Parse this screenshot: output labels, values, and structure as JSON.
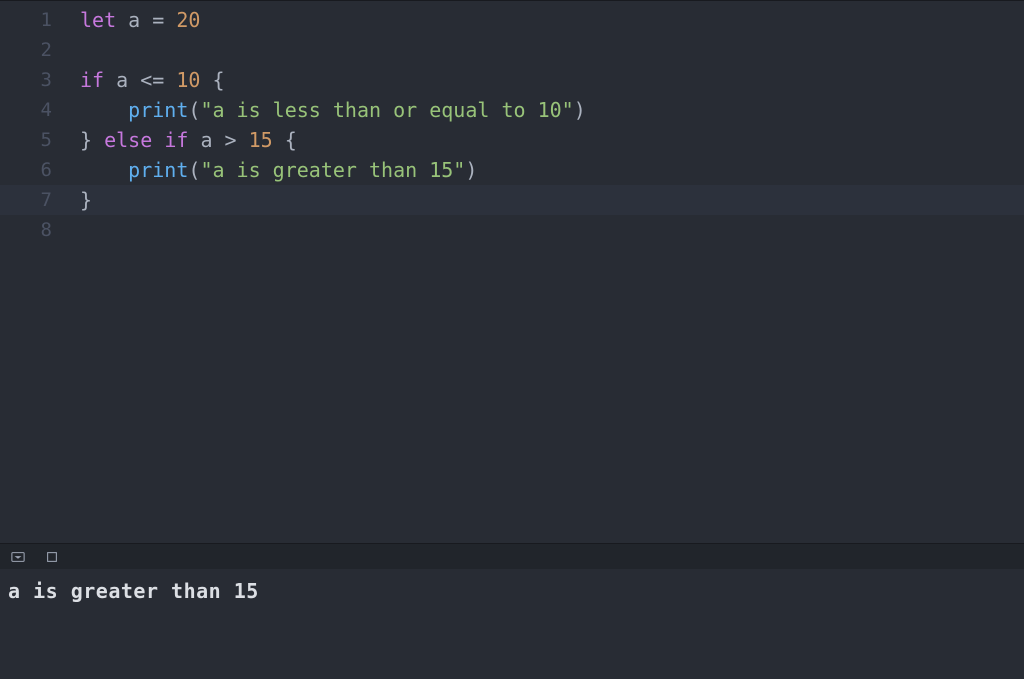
{
  "editor": {
    "lines": [
      {
        "num": "1",
        "highlighted": false
      },
      {
        "num": "2",
        "highlighted": false
      },
      {
        "num": "3",
        "highlighted": false
      },
      {
        "num": "4",
        "highlighted": false
      },
      {
        "num": "5",
        "highlighted": false
      },
      {
        "num": "6",
        "highlighted": false
      },
      {
        "num": "7",
        "highlighted": true
      },
      {
        "num": "8",
        "highlighted": false
      }
    ],
    "tokens": {
      "l1_let": "let",
      "l1_sp1": " ",
      "l1_a": "a",
      "l1_sp2": " ",
      "l1_eq": "=",
      "l1_sp3": " ",
      "l1_20": "20",
      "l3_if": "if",
      "l3_sp1": " ",
      "l3_a": "a",
      "l3_sp2": " ",
      "l3_lte": "<=",
      "l3_sp3": " ",
      "l3_10": "10",
      "l3_sp4": " ",
      "l3_brace": "{",
      "l4_indent": "    ",
      "l4_print": "print",
      "l4_lparen": "(",
      "l4_str": "\"a is less than or equal to 10\"",
      "l4_rparen": ")",
      "l5_rbrace": "}",
      "l5_sp1": " ",
      "l5_else": "else",
      "l5_sp2": " ",
      "l5_if": "if",
      "l5_sp3": " ",
      "l5_a": "a",
      "l5_sp4": " ",
      "l5_gt": ">",
      "l5_sp5": " ",
      "l5_15": "15",
      "l5_sp6": " ",
      "l5_lbrace": "{",
      "l6_indent": "    ",
      "l6_print": "print",
      "l6_lparen": "(",
      "l6_str": "\"a is greater than 15\"",
      "l6_rparen": ")",
      "l7_rbrace": "}"
    }
  },
  "console": {
    "output": "a is greater than 15"
  }
}
